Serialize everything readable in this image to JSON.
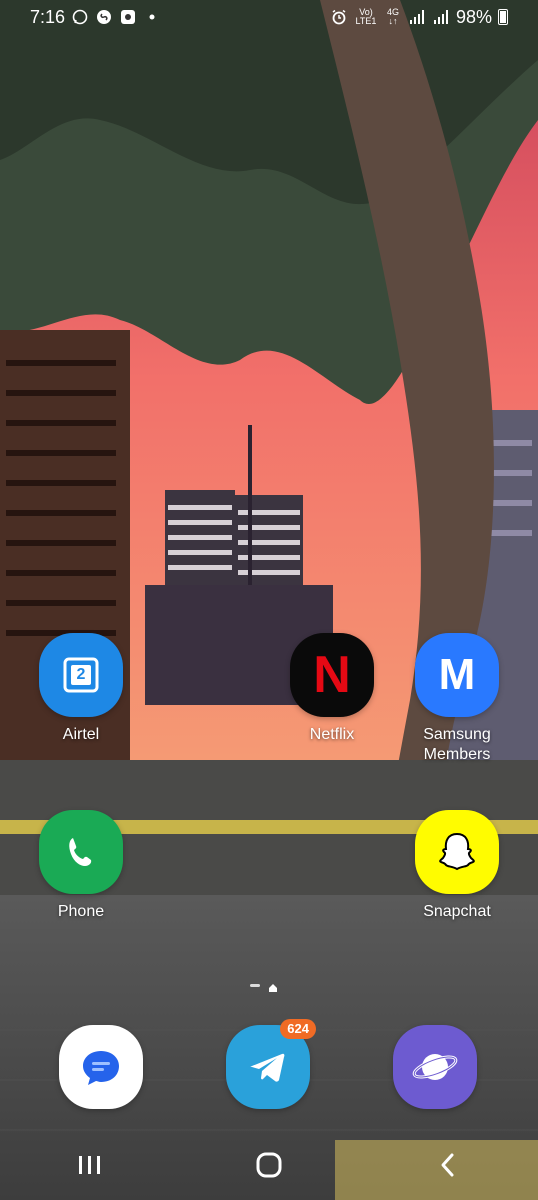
{
  "status_bar": {
    "time": "7:16",
    "network_label_top": "Vo)",
    "network_label_bottom": "LTE1",
    "data_label_top": "4G",
    "battery_percent": "98%",
    "left_icons": [
      "whatsapp-icon",
      "shazam-icon",
      "camera-app-icon",
      "dot-icon"
    ],
    "right_icons": [
      "alarm-icon",
      "volte-icon",
      "4g-icon",
      "signal-icon",
      "signal-icon",
      "battery-icon"
    ]
  },
  "apps": [
    {
      "id": "airtel",
      "label": "Airtel",
      "icon_text": "2",
      "color": "#1e88e5"
    },
    {
      "id": "netflix",
      "label": "Netflix",
      "icon_text": "N",
      "color": "#0a0a0a"
    },
    {
      "id": "samsung-members",
      "label": "Samsung Members",
      "label_line1": "Samsung",
      "label_line2": "Members",
      "icon_text": "M",
      "color": "#2979ff"
    },
    {
      "id": "phone",
      "label": "Phone",
      "color": "#1aaa55"
    },
    {
      "id": "snapchat",
      "label": "Snapchat",
      "color": "#fffc00"
    }
  ],
  "dock": [
    {
      "id": "messages",
      "label": "Messages",
      "color": "#ffffff"
    },
    {
      "id": "telegram",
      "label": "Telegram",
      "badge": "624",
      "color": "#2aa1da"
    },
    {
      "id": "samsung-internet",
      "label": "Samsung Internet",
      "color": "#6d5bd0"
    }
  ],
  "navigation": {
    "recents_icon": "recents-icon",
    "home_icon": "home-icon",
    "back_icon": "back-icon"
  }
}
